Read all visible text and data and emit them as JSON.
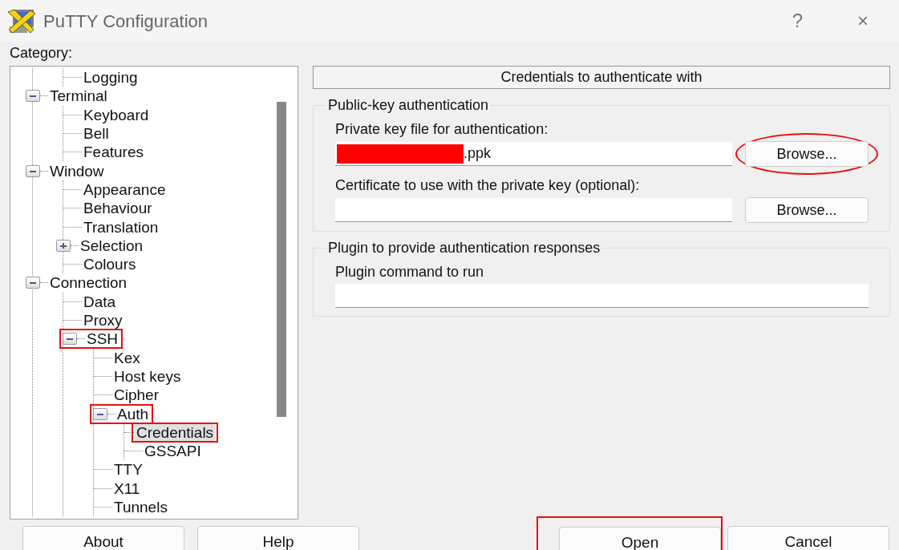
{
  "window": {
    "title": "PuTTY Configuration",
    "help_button": "?",
    "close_button": "×"
  },
  "category_label": "Category:",
  "tree": {
    "continued": [
      {
        "label": "Logging",
        "selected": false,
        "annotated": false
      }
    ],
    "items": [
      {
        "label": "Terminal",
        "expanded": true,
        "selected": false,
        "annotated": false,
        "children": [
          {
            "label": "Keyboard",
            "selected": false,
            "annotated": false
          },
          {
            "label": "Bell",
            "selected": false,
            "annotated": false
          },
          {
            "label": "Features",
            "selected": false,
            "annotated": false
          }
        ]
      },
      {
        "label": "Window",
        "expanded": true,
        "selected": false,
        "annotated": false,
        "children": [
          {
            "label": "Appearance",
            "selected": false,
            "annotated": false
          },
          {
            "label": "Behaviour",
            "selected": false,
            "annotated": false
          },
          {
            "label": "Translation",
            "selected": false,
            "annotated": false
          },
          {
            "label": "Selection",
            "expanded": false,
            "selected": false,
            "annotated": false
          },
          {
            "label": "Colours",
            "selected": false,
            "annotated": false
          }
        ]
      },
      {
        "label": "Connection",
        "expanded": true,
        "selected": false,
        "annotated": false,
        "children": [
          {
            "label": "Data",
            "selected": false,
            "annotated": false
          },
          {
            "label": "Proxy",
            "selected": false,
            "annotated": false
          },
          {
            "label": "SSH",
            "expanded": true,
            "selected": false,
            "annotated": true,
            "children": [
              {
                "label": "Kex",
                "selected": false,
                "annotated": false
              },
              {
                "label": "Host keys",
                "selected": false,
                "annotated": false
              },
              {
                "label": "Cipher",
                "selected": false,
                "annotated": false
              },
              {
                "label": "Auth",
                "expanded": true,
                "selected": false,
                "annotated": true,
                "children": [
                  {
                    "label": "Credentials",
                    "selected": true,
                    "annotated": true
                  },
                  {
                    "label": "GSSAPI",
                    "selected": false,
                    "annotated": false
                  }
                ]
              },
              {
                "label": "TTY",
                "selected": false,
                "annotated": false
              },
              {
                "label": "X11",
                "selected": false,
                "annotated": false
              },
              {
                "label": "Tunnels",
                "selected": false,
                "annotated": false
              }
            ]
          }
        ]
      }
    ]
  },
  "panel": {
    "header": "Credentials to authenticate with",
    "groups": [
      {
        "title": "Public-key authentication",
        "fields": [
          {
            "label": "Private key file for authentication:",
            "value": ".ppk",
            "redacted": true,
            "button": {
              "label": "Browse...",
              "annotated": true
            }
          },
          {
            "label": "Certificate to use with the private key (optional):",
            "redacted": false,
            "button": {
              "label": "Browse...",
              "annotated": false
            }
          }
        ]
      },
      {
        "title": "Plugin to provide authentication responses",
        "fields": [
          {
            "label": "Plugin command to run",
            "redacted": false
          }
        ]
      }
    ]
  },
  "left_buttons": [
    {
      "label": "About",
      "annotated": false
    },
    {
      "label": "Help",
      "annotated": false
    }
  ],
  "right_buttons": [
    {
      "label": "Open",
      "annotated": true
    },
    {
      "label": "Cancel",
      "annotated": false
    }
  ]
}
